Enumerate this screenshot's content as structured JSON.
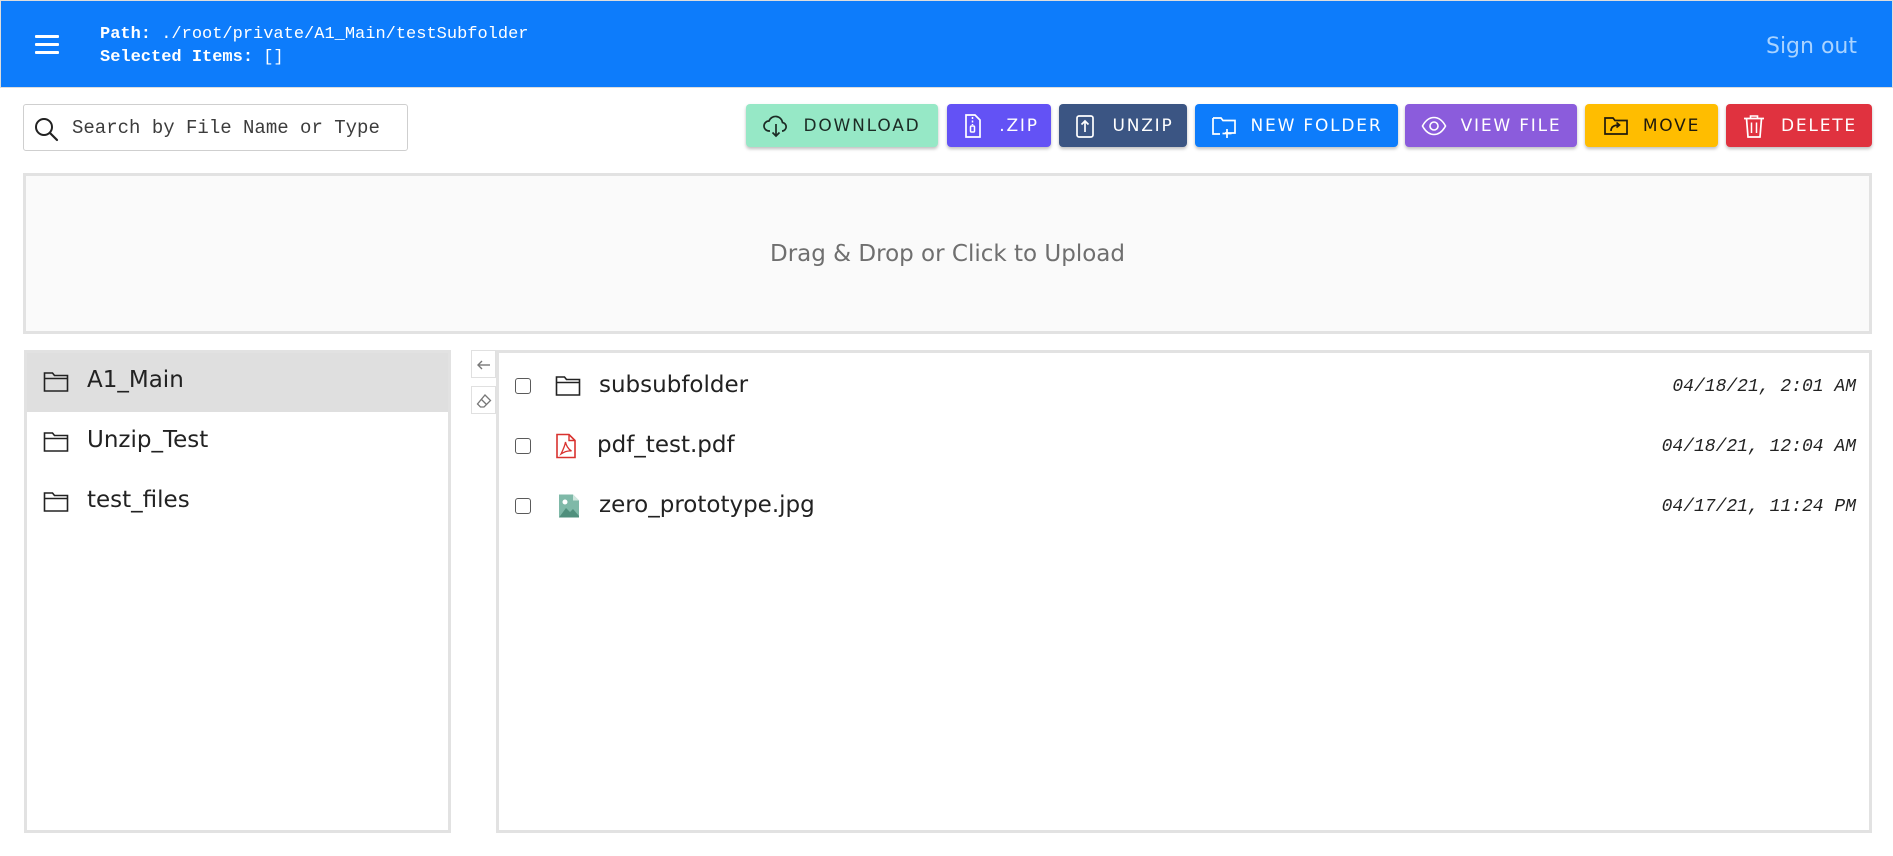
{
  "header": {
    "path_label": "Path:",
    "path_value": "./root/private/A1_Main/testSubfolder",
    "selected_label": "Selected Items:",
    "selected_value": "[]",
    "signout": "Sign out",
    "menu_icon": "hamburger-menu-icon"
  },
  "search": {
    "placeholder": "Search by File Name or Type",
    "value": "",
    "icon": "search-icon"
  },
  "toolbar": {
    "download": "DOWNLOAD",
    "zip": ".ZIP",
    "unzip": "UNZIP",
    "new_folder": "NEW FOLDER",
    "view_file": "VIEW FILE",
    "move": "MOVE",
    "delete": "DELETE"
  },
  "dropzone": {
    "label": "Drag & Drop or Click to Upload"
  },
  "sidebar": {
    "items": [
      {
        "label": "A1_Main",
        "icon": "folder-icon",
        "active": true
      },
      {
        "label": "Unzip_Test",
        "icon": "folder-icon",
        "active": false
      },
      {
        "label": "test_files",
        "icon": "folder-icon",
        "active": false
      }
    ]
  },
  "files": [
    {
      "name": "subsubfolder",
      "date": "04/18/21, 2:01 AM",
      "icon": "folder-icon",
      "checked": false
    },
    {
      "name": "pdf_test.pdf",
      "date": "04/18/21, 12:04 AM",
      "icon": "pdf-file-icon",
      "checked": false
    },
    {
      "name": "zero_prototype.jpg",
      "date": "04/17/21, 11:24 PM",
      "icon": "image-file-icon",
      "checked": false
    }
  ],
  "colors": {
    "header_bg": "#0d7cfb",
    "download": "#96e8c6",
    "zip": "#6352f5",
    "unzip": "#3b5583",
    "new_folder": "#0d7cfb",
    "view_file": "#8b5cdc",
    "move": "#ffbd00",
    "delete": "#e0323f"
  }
}
